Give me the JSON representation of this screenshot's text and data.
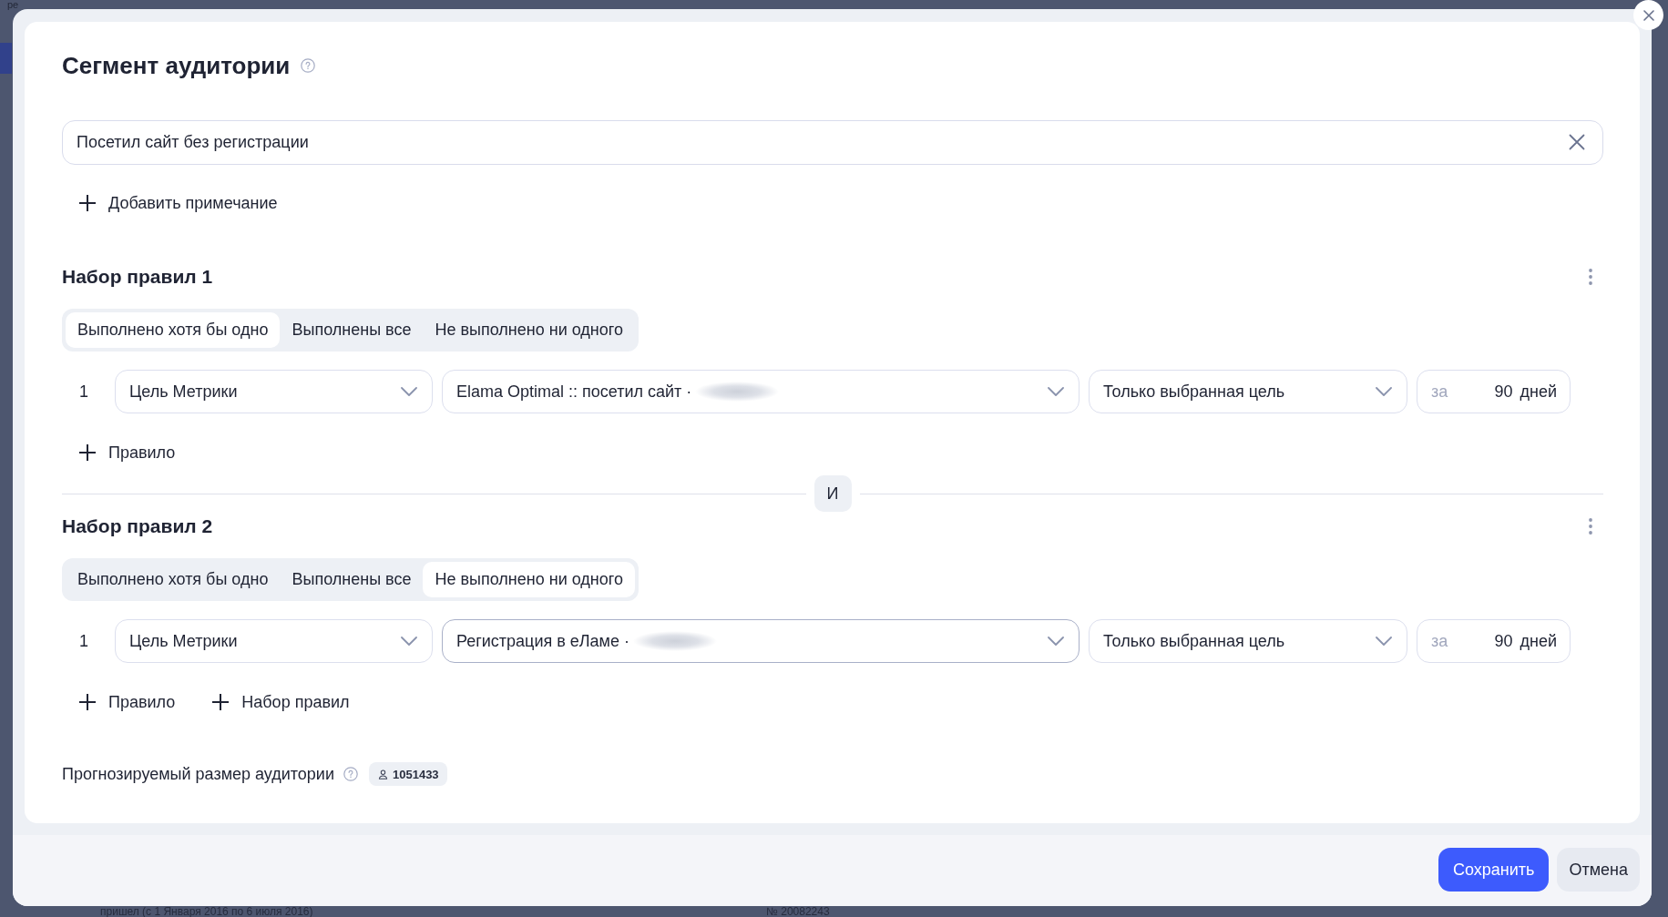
{
  "background_page": {
    "top_fragment": "ре",
    "footer_texts": [
      "пришел (с 1 Января 2016 по 6 июля 2016)",
      "№ 20082243"
    ]
  },
  "dialog": {
    "title": "Сегмент аудитории",
    "name_field": {
      "value": "Посетил сайт без регистрации"
    },
    "add_note": "Добавить примечание",
    "rule_sets": [
      {
        "title": "Набор правил 1",
        "modes": [
          {
            "label": "Выполнено хотя бы одно",
            "selected": true
          },
          {
            "label": "Выполнены все",
            "selected": false
          },
          {
            "label": "Не выполнено ни одного",
            "selected": false
          }
        ],
        "rules": [
          {
            "number": "1",
            "condition": "Цель Метрики",
            "goal": {
              "text": "Elama Optimal :: посетил сайт ·",
              "redacted": true,
              "highlighted": false
            },
            "scope": "Только выбранная цель",
            "period": {
              "prefix": "за",
              "value": "90",
              "unit": "дней"
            }
          }
        ],
        "actions": [
          "Правило"
        ]
      },
      {
        "title": "Набор правил 2",
        "modes": [
          {
            "label": "Выполнено хотя бы одно",
            "selected": false
          },
          {
            "label": "Выполнены все",
            "selected": false
          },
          {
            "label": "Не выполнено ни одного",
            "selected": true
          }
        ],
        "rules": [
          {
            "number": "1",
            "condition": "Цель Метрики",
            "goal": {
              "text": "Регистрация в еЛаме ·",
              "redacted": true,
              "highlighted": true
            },
            "scope": "Только выбранная цель",
            "period": {
              "prefix": "за",
              "value": "90",
              "unit": "дней"
            }
          }
        ],
        "actions": [
          "Правило",
          "Набор правил"
        ]
      }
    ],
    "joiner": "И",
    "audience": {
      "label": "Прогнозируемый размер аудитории",
      "size": "1051433"
    },
    "buttons": [
      {
        "kind": "primary",
        "label": "Сохранить"
      },
      {
        "kind": "secondary",
        "label": "Отмена"
      }
    ]
  }
}
